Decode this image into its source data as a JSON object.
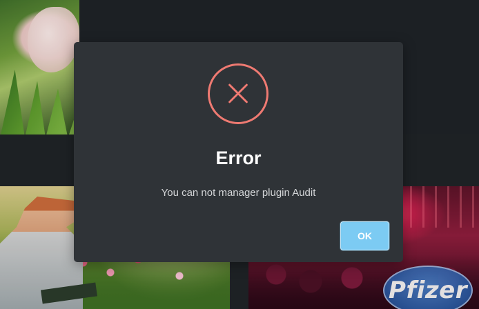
{
  "dialog": {
    "title": "Error",
    "message": "You can not manager plugin Audit",
    "ok_label": "OK",
    "icon": "error-x-circle-icon"
  },
  "background": {
    "logo_text": "Pfizer"
  },
  "colors": {
    "error_accent": "#ef7a72",
    "dialog_bg": "#2f3337",
    "ok_button": "#7ccbf3"
  }
}
